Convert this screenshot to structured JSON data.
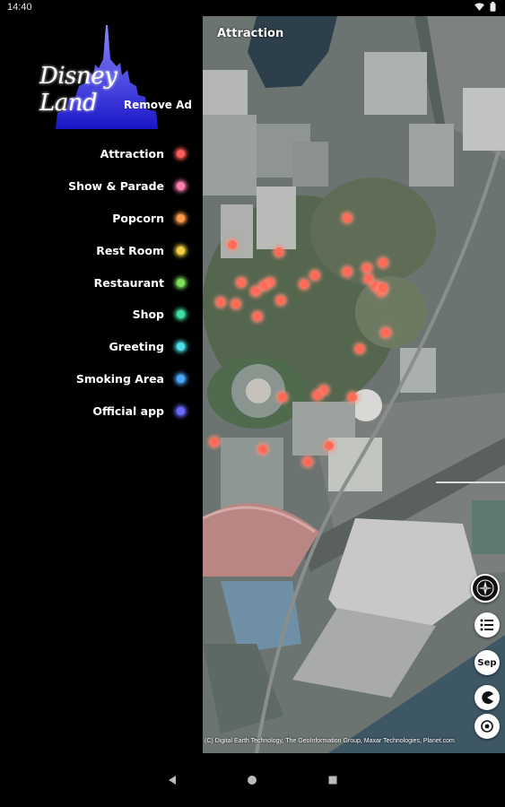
{
  "status": {
    "time": "14:40"
  },
  "app": {
    "logo_text": "Disney Land",
    "remove_ad": "Remove Ad"
  },
  "menu": [
    {
      "label": "Attraction",
      "color": "#ff5a5a",
      "icon": "attraction-dot-icon"
    },
    {
      "label": "Show & Parade",
      "color": "#ff7eb3",
      "icon": "show-dot-icon"
    },
    {
      "label": "Popcorn",
      "color": "#ff9a4a",
      "icon": "popcorn-dot-icon"
    },
    {
      "label": "Rest Room",
      "color": "#f0d040",
      "icon": "restroom-dot-icon"
    },
    {
      "label": "Restaurant",
      "color": "#7ee05a",
      "icon": "restaurant-dot-icon"
    },
    {
      "label": "Shop",
      "color": "#3ee0a0",
      "icon": "shop-dot-icon"
    },
    {
      "label": "Greeting",
      "color": "#4ee0e8",
      "icon": "greeting-dot-icon"
    },
    {
      "label": "Smoking Area",
      "color": "#4aa8ff",
      "icon": "smoking-dot-icon"
    },
    {
      "label": "Official app",
      "color": "#6a6aff",
      "icon": "official-app-dot-icon"
    }
  ],
  "map": {
    "title": "Attraction",
    "copyright": "(C) Digital Earth Technology, The GeoInformation Group, Maxar Technologies, Planet.com",
    "sep_label": "Sep",
    "buttons": [
      "compass-icon",
      "list-icon",
      "sep-button",
      "pacman-icon",
      "my-location-icon"
    ]
  }
}
